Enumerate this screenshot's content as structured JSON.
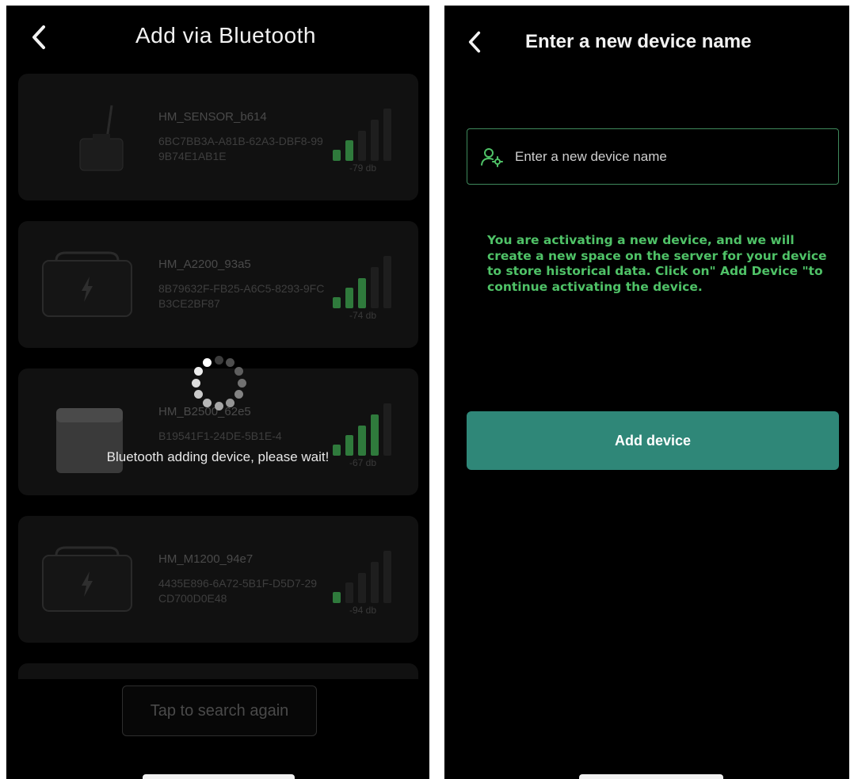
{
  "left_screen": {
    "title": "Add via Bluetooth",
    "devices": [
      {
        "name": "HM_SENSOR_b614",
        "uuid": "6BC7BB3A-A81B-62A3-DBF8-999B74E1AB1E",
        "rssi": "-79 db",
        "icon": "sensor-device-icon",
        "signal_level": 2
      },
      {
        "name": "HM_A2200_93a5",
        "uuid": "8B79632F-FB25-A6C5-8293-9FCB3CE2BF87",
        "rssi": "-74 db",
        "icon": "power-station-icon",
        "signal_level": 3
      },
      {
        "name": "HM_B2500_62e5",
        "uuid": "B19541F1-24DE-5B1E-4",
        "rssi": "-67 db",
        "icon": "battery-box-icon",
        "signal_level": 4
      },
      {
        "name": "HM_M1200_94e7",
        "uuid": "4435E896-6A72-5B1F-D5D7-29CD700D0E48",
        "rssi": "-94 db",
        "icon": "power-station-icon",
        "signal_level": 1
      }
    ],
    "loading_message": "Bluetooth adding device, please wait!",
    "search_again_label": "Tap to search again"
  },
  "right_screen": {
    "title": "Enter a new device name",
    "name_input": {
      "placeholder": "Enter a new device name",
      "value": ""
    },
    "info_text": "You are activating a new device, and we will create a new space on the server for your device to store historical data. Click on\" Add Device \"to continue activating the device.",
    "add_button_label": "Add device"
  },
  "colors": {
    "background": "#000000",
    "accent_green": "#4fc267",
    "input_border": "#3f8a5c",
    "button_teal": "#2f8778",
    "signal_active": "#2f7a3c",
    "signal_inactive": "#1e1e1e"
  }
}
